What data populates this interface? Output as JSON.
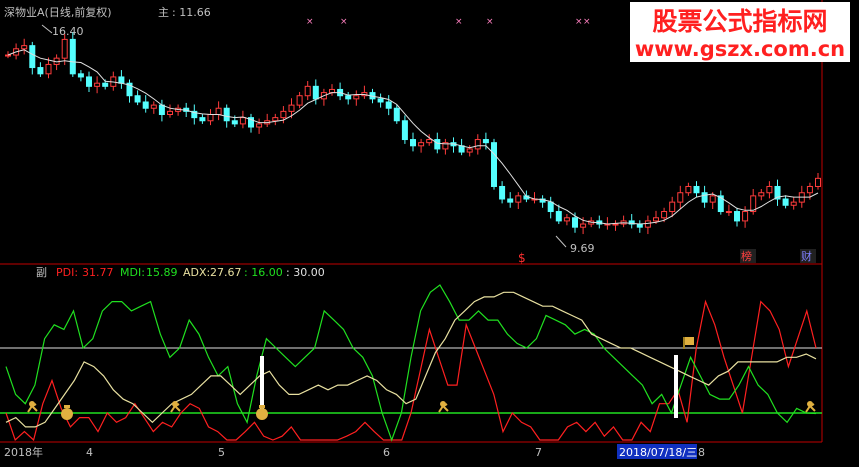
{
  "header": {
    "stock_title": "深物业A(日线,前复权)",
    "main_label": "主",
    "main_value": ": 11.66"
  },
  "watermark": {
    "line1": "股票公式指标网",
    "line2": "www.gszx.com.cn",
    "color1": "#ff2020",
    "color2": "#ff2020"
  },
  "indicator_header": {
    "label": "副",
    "pdi_label": "PDI:",
    "pdi_value": "31.77",
    "mdi_label": "MDI:",
    "mdi_value": "15.89",
    "adx_label": "ADX:",
    "adx_value": "27.67",
    "level1": ": 16.00",
    "level2": ": 30.00"
  },
  "annotations": {
    "high_label": "16.40",
    "low_label": "9.69",
    "s_marker": "$",
    "bang_marker": "榜",
    "cai_marker": "财",
    "x_markers": [
      "×",
      "×",
      "×",
      "×",
      "×",
      "×"
    ]
  },
  "x_axis": {
    "labels": [
      "2018年",
      "4",
      "5",
      "6",
      "7",
      "8"
    ],
    "cursor_date": "2018/07/18/三"
  },
  "colors": {
    "up": "#ff3c3c",
    "down": "#54ffff",
    "pdi": "#ff2020",
    "mdi": "#20e020",
    "adx": "#e8e0a0",
    "level16": "#20e020",
    "level30": "#e0e0e0",
    "signal_bar": "#ffffff",
    "text_gray": "#c0c0c0",
    "cursor_bg": "#1030c0"
  },
  "chart_data": [
    {
      "type": "candlestick",
      "price_range": [
        9.69,
        16.4
      ],
      "close_path": [
        15.6,
        15.8,
        15.9,
        15.2,
        15.0,
        15.3,
        15.5,
        16.1,
        15.0,
        14.9,
        14.6,
        14.7,
        14.6,
        14.9,
        14.7,
        14.3,
        14.1,
        13.9,
        14.0,
        13.7,
        13.8,
        13.9,
        13.8,
        13.6,
        13.5,
        13.7,
        13.9,
        13.5,
        13.4,
        13.6,
        13.3,
        13.4,
        13.5,
        13.6,
        13.8,
        14.0,
        14.3,
        14.6,
        14.2,
        14.4,
        14.5,
        14.3,
        14.2,
        14.3,
        14.4,
        14.2,
        14.1,
        13.9,
        13.5,
        12.9,
        12.7,
        12.8,
        12.9,
        12.6,
        12.8,
        12.7,
        12.5,
        12.6,
        12.9,
        12.8,
        11.4,
        11.0,
        10.9,
        11.1,
        11.0,
        11.0,
        10.9,
        10.6,
        10.3,
        10.4,
        10.1,
        10.2,
        10.3,
        10.2,
        10.2,
        10.2,
        10.3,
        10.2,
        10.1,
        10.3,
        10.4,
        10.6,
        10.9,
        11.2,
        11.4,
        11.2,
        10.9,
        11.1,
        10.6,
        10.6,
        10.3,
        10.6,
        11.1,
        11.2,
        11.4,
        11.0,
        10.8,
        10.9,
        11.2,
        11.4,
        11.66
      ]
    },
    {
      "type": "line",
      "series": [
        {
          "name": "PDI",
          "values": [
            16,
            10,
            12,
            9,
            18,
            23,
            17,
            13,
            15,
            15,
            12,
            16,
            14,
            15,
            18,
            15,
            12,
            14,
            13,
            16,
            18,
            17,
            13,
            12,
            8,
            10,
            12,
            14,
            11,
            9,
            11,
            13,
            5,
            8,
            5,
            3,
            6,
            11,
            12,
            14,
            12,
            10,
            9,
            10,
            16,
            25,
            34,
            28,
            22,
            22,
            35,
            30,
            25,
            20,
            12,
            16,
            14,
            13,
            5,
            5,
            10,
            13,
            14,
            12,
            14,
            11,
            13,
            5,
            10,
            14,
            12,
            18,
            18,
            21,
            14,
            30,
            40,
            35,
            28,
            22,
            16,
            28,
            40,
            38,
            34,
            26,
            32,
            38,
            30
          ]
        },
        {
          "name": "MDI",
          "values": [
            26,
            20,
            18,
            22,
            32,
            35,
            34,
            38,
            30,
            32,
            38,
            40,
            40,
            38,
            39,
            40,
            33,
            28,
            30,
            36,
            33,
            28,
            24,
            26,
            18,
            14,
            24,
            32,
            30,
            28,
            26,
            28,
            30,
            38,
            36,
            34,
            30,
            28,
            24,
            16,
            10,
            16,
            28,
            38,
            42,
            46,
            40,
            36,
            36,
            38,
            36,
            36,
            33,
            31,
            30,
            32,
            37,
            36,
            35,
            33,
            34,
            33,
            30,
            28,
            26,
            24,
            22,
            18,
            20,
            16,
            22,
            28,
            24,
            20,
            19,
            19,
            22,
            26,
            22,
            20,
            16,
            14,
            17,
            16,
            15.9
          ]
        },
        {
          "name": "ADX",
          "values": [
            14,
            15,
            13,
            13,
            14,
            17,
            20,
            23,
            27,
            26,
            24,
            21,
            19,
            18,
            16,
            14,
            16,
            18,
            19,
            20,
            22,
            24,
            24,
            22,
            20,
            22,
            24,
            25,
            22,
            20,
            20,
            21,
            22,
            21,
            22,
            22,
            23,
            24,
            23,
            21,
            20,
            18,
            19,
            24,
            29,
            32,
            36,
            38,
            40,
            41,
            41,
            42,
            42,
            41,
            40,
            39,
            39,
            38,
            37,
            36,
            33,
            32,
            31,
            30,
            30,
            29,
            28,
            27,
            26,
            25,
            24,
            23,
            22,
            24,
            25,
            27,
            27,
            27,
            27,
            27,
            28,
            28,
            28.7,
            27.67
          ]
        }
      ],
      "levels": [
        16,
        30
      ]
    }
  ]
}
